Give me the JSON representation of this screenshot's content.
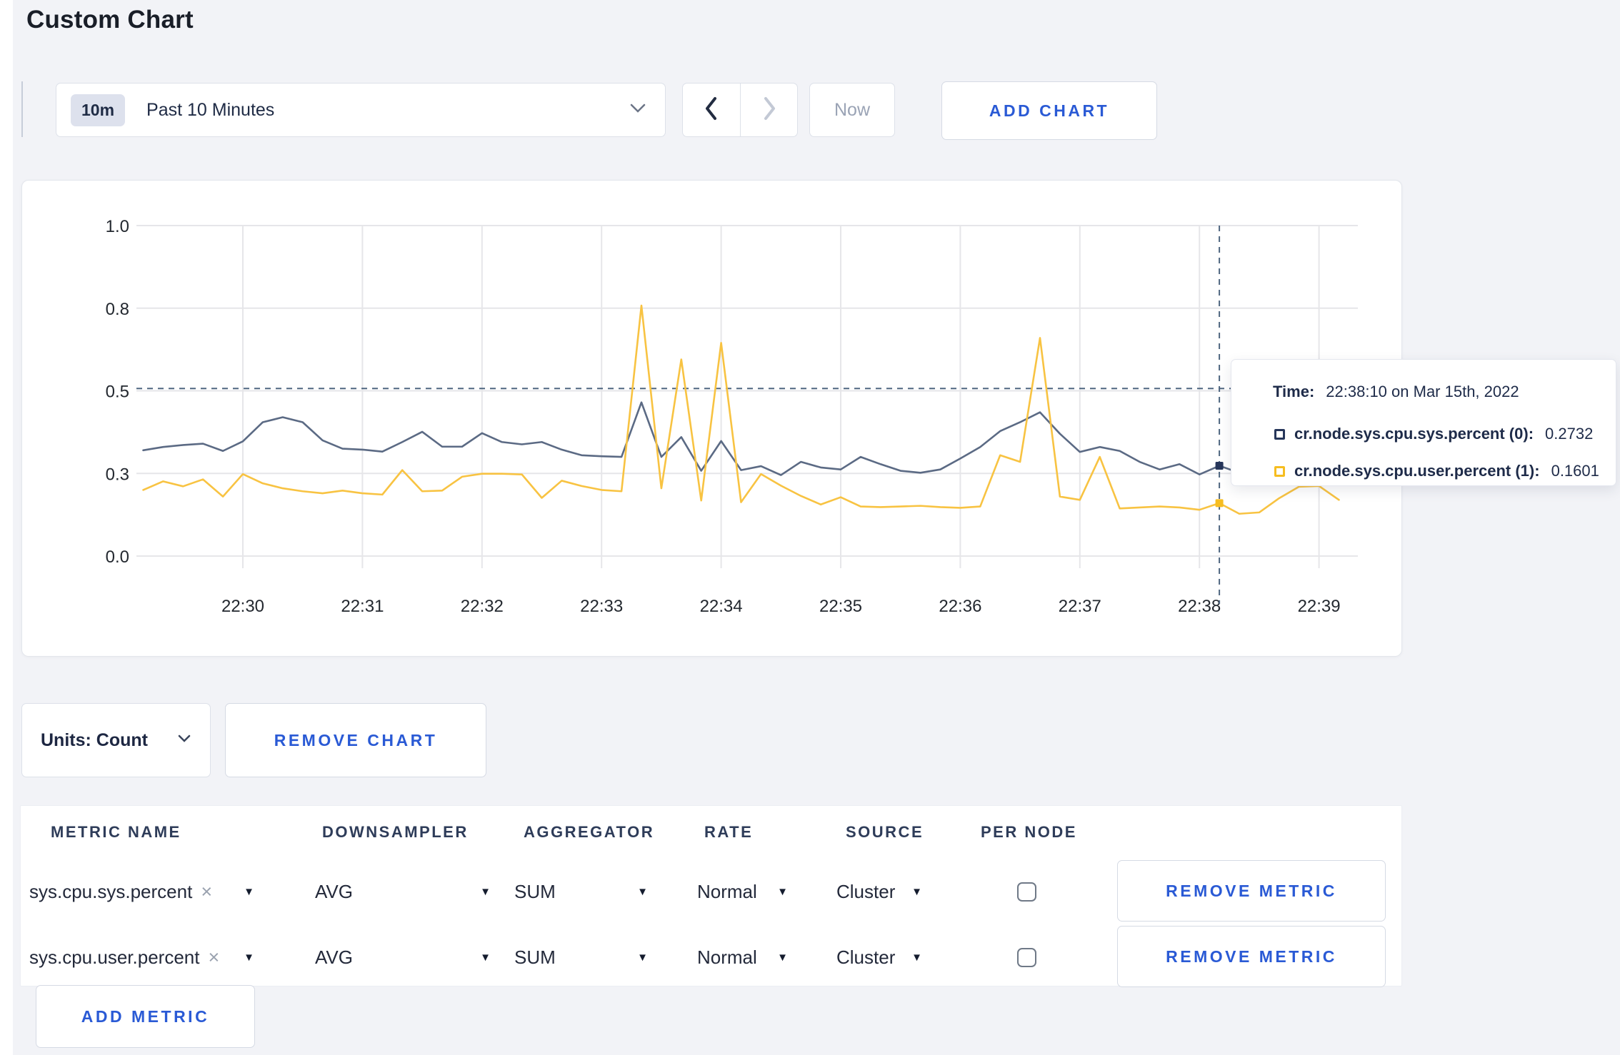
{
  "page": {
    "title": "Custom Chart"
  },
  "toolbar": {
    "range_badge": "10m",
    "range_label": "Past 10 Minutes",
    "prev_icon": "chevron-left",
    "next_icon": "chevron-right",
    "now_label": "Now",
    "add_chart_label": "ADD CHART"
  },
  "colors": {
    "accent_blue": "#2a5ad5",
    "series_sys_line": "#5b6a84",
    "series_sys_swatch": "#26365a",
    "series_user_line": "#f8c342",
    "series_user_swatch": "#f6bd20",
    "gridline": "#e6e6e9",
    "crosshair": "#4f6680"
  },
  "chart_data": {
    "type": "line",
    "title": "",
    "xlabel": "",
    "ylabel": "",
    "x_start_time": "22:29:10",
    "x_end_time": "22:39:10",
    "x_step_seconds": 10,
    "x_axis": {
      "tick_labels": [
        "22:30",
        "22:31",
        "22:32",
        "22:33",
        "22:34",
        "22:35",
        "22:36",
        "22:37",
        "22:38",
        "22:39"
      ],
      "tick_seconds": [
        50,
        110,
        170,
        230,
        290,
        350,
        410,
        470,
        530,
        590
      ]
    },
    "y_axis": {
      "tick_labels": [
        "0.0",
        "0.3",
        "0.5",
        "0.8",
        "1.0"
      ],
      "tick_values": [
        0,
        0.25,
        0.5,
        0.75,
        1.0
      ],
      "range": [
        0,
        1.0
      ]
    },
    "grid": true,
    "legend_position": "tooltip-only",
    "series": [
      {
        "name": "cr.node.sys.cpu.sys.percent (0)",
        "color": "#5b6a84",
        "swatch_color": "#26365a",
        "values": [
          0.32,
          0.33,
          0.336,
          0.34,
          0.318,
          0.347,
          0.405,
          0.42,
          0.405,
          0.35,
          0.325,
          0.322,
          0.316,
          0.345,
          0.376,
          0.331,
          0.331,
          0.372,
          0.345,
          0.338,
          0.345,
          0.322,
          0.305,
          0.302,
          0.3,
          0.465,
          0.3,
          0.36,
          0.258,
          0.348,
          0.26,
          0.272,
          0.245,
          0.285,
          0.268,
          0.262,
          0.3,
          0.278,
          0.258,
          0.252,
          0.262,
          0.295,
          0.33,
          0.378,
          0.405,
          0.435,
          0.37,
          0.315,
          0.33,
          0.318,
          0.285,
          0.262,
          0.278,
          0.247,
          0.2732,
          0.252,
          0.258,
          0.248,
          0.255,
          0.262,
          0.255
        ]
      },
      {
        "name": "cr.node.sys.cpu.user.percent (1)",
        "color": "#f8c342",
        "swatch_color": "#f6bd20",
        "values": [
          0.2,
          0.226,
          0.211,
          0.232,
          0.18,
          0.248,
          0.22,
          0.205,
          0.196,
          0.19,
          0.198,
          0.19,
          0.186,
          0.26,
          0.196,
          0.198,
          0.24,
          0.249,
          0.249,
          0.247,
          0.176,
          0.228,
          0.212,
          0.2,
          0.196,
          0.758,
          0.205,
          0.595,
          0.168,
          0.645,
          0.163,
          0.248,
          0.213,
          0.182,
          0.156,
          0.178,
          0.15,
          0.148,
          0.15,
          0.152,
          0.148,
          0.146,
          0.15,
          0.305,
          0.285,
          0.66,
          0.18,
          0.17,
          0.3,
          0.144,
          0.147,
          0.15,
          0.147,
          0.14,
          0.1601,
          0.128,
          0.132,
          0.175,
          0.21,
          0.212,
          0.17
        ]
      }
    ],
    "crosshair": {
      "x_seconds": 540,
      "hline_value": 0.507,
      "point_values": [
        0.2732,
        0.1601
      ]
    }
  },
  "tooltip": {
    "time_label": "Time:",
    "time_value": "22:38:10 on Mar 15th, 2022",
    "rows": [
      {
        "label": "cr.node.sys.cpu.sys.percent (0):",
        "value": "0.2732"
      },
      {
        "label": "cr.node.sys.cpu.user.percent (1):",
        "value": "0.1601"
      }
    ]
  },
  "chart_controls": {
    "units_label": "Units: Count",
    "remove_chart_label": "REMOVE CHART"
  },
  "metrics_table": {
    "headers": [
      "METRIC NAME",
      "DOWNSAMPLER",
      "AGGREGATOR",
      "RATE",
      "SOURCE",
      "PER NODE"
    ],
    "rows": [
      {
        "name": "sys.cpu.sys.percent",
        "remove_x": "×",
        "downsampler": "AVG",
        "aggregator": "SUM",
        "rate": "Normal",
        "source": "Cluster",
        "per_node_checked": false,
        "remove_label": "REMOVE METRIC"
      },
      {
        "name": "sys.cpu.user.percent",
        "remove_x": "×",
        "downsampler": "AVG",
        "aggregator": "SUM",
        "rate": "Normal",
        "source": "Cluster",
        "per_node_checked": false,
        "remove_label": "REMOVE METRIC"
      }
    ],
    "add_metric_label": "ADD METRIC"
  }
}
